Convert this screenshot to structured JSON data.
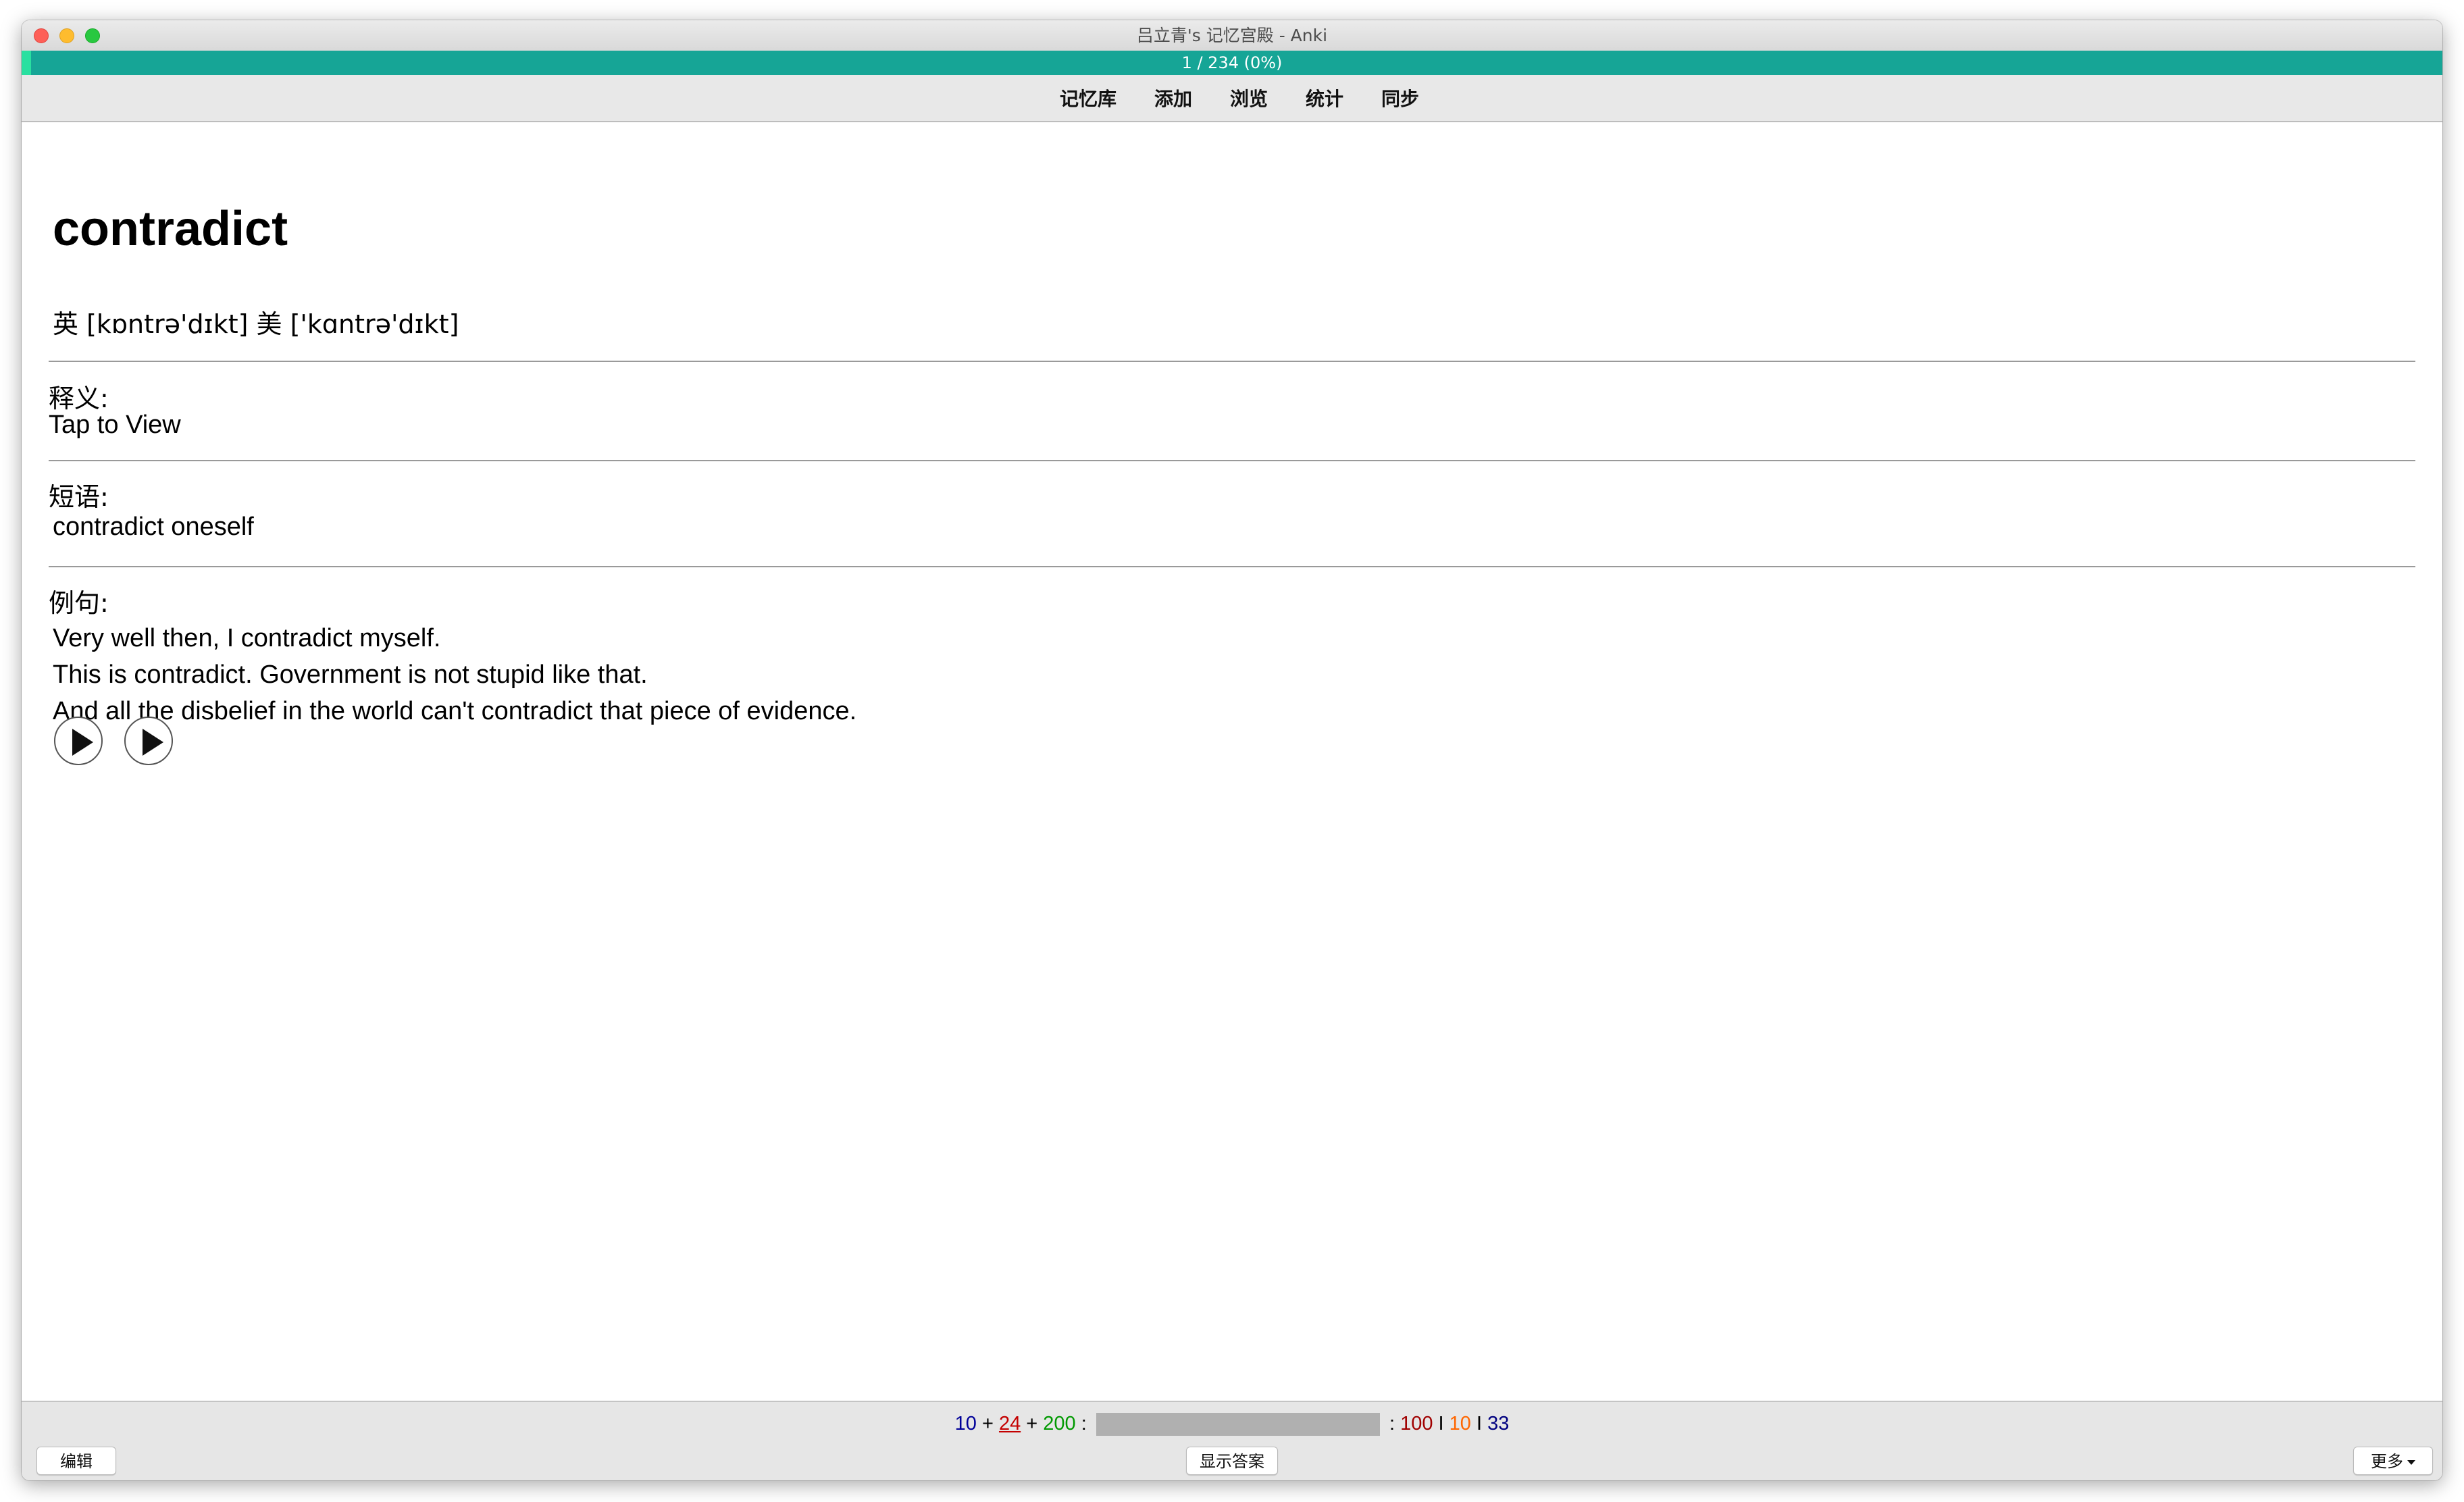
{
  "window": {
    "title": "吕立青's 记忆宫殿 - Anki"
  },
  "progress": {
    "text": "1 / 234 (0%)",
    "fraction": 0.0043
  },
  "toolbar": {
    "items": [
      {
        "label": "记忆库"
      },
      {
        "label": "添加"
      },
      {
        "label": "浏览"
      },
      {
        "label": "统计"
      },
      {
        "label": "同步"
      }
    ]
  },
  "card": {
    "word": "contradict",
    "phonetic": "英 [kɒntrə'dɪkt] 美 ['kɑntrə'dɪkt]",
    "definition": {
      "label": "释义:",
      "text": "Tap to View"
    },
    "phrases": {
      "label": "短语:",
      "items": [
        "contradict oneself"
      ]
    },
    "examples": {
      "label": "例句:",
      "items": [
        "Very well then, I contradict myself.",
        "This is contradict. Government is not stupid like that.",
        "And all the disbelief in the world can't contradict that piece of evidence."
      ]
    }
  },
  "bottom": {
    "counts": {
      "new": "10",
      "learning": "24",
      "review": "200",
      "stat_1": "100",
      "stat_2": "10",
      "stat_3": "33"
    },
    "edit_label": "编辑",
    "show_answer_label": "显示答案",
    "more_label": "更多"
  },
  "colors": {
    "progress": "#16a596",
    "progress_fill": "#29e0a0",
    "new_count": "#000099",
    "learning_count": "#c40000",
    "review_count": "#009900"
  }
}
